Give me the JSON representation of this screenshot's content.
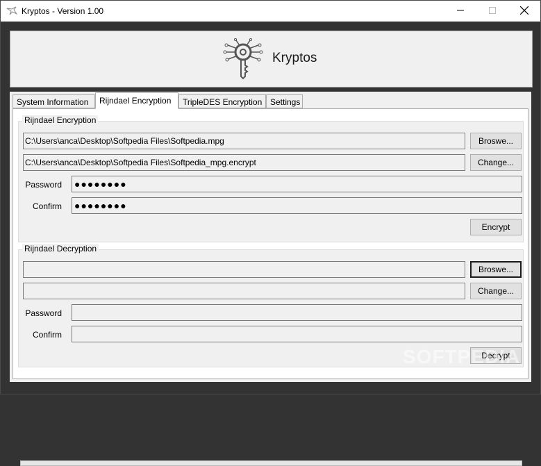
{
  "window": {
    "title": "Kryptos - Version 1.00",
    "icon": "bird-app-icon",
    "controls": {
      "minimize": "minimize-icon",
      "maximize": "maximize-icon",
      "close": "close-icon"
    }
  },
  "banner": {
    "title": "Kryptos",
    "logo": "key-circuit-logo"
  },
  "tabs": [
    {
      "label": "System Information"
    },
    {
      "label": "Rijndael Encryption"
    },
    {
      "label": "TripleDES Encryption"
    },
    {
      "label": "Settings"
    }
  ],
  "encryption": {
    "group_label": "Rijndael Encryption",
    "source_path": "C:\\Users\\anca\\Desktop\\Softpedia Files\\Softpedia.mpg",
    "dest_path": "C:\\Users\\anca\\Desktop\\Softpedia Files\\Softpedia_mpg.encrypt",
    "browse_label": "Broswe...",
    "change_label": "Change...",
    "password_label": "Password",
    "password_value": "●●●●●●●●",
    "confirm_label": "Confirm",
    "confirm_value": "●●●●●●●●",
    "action_label": "Encrypt"
  },
  "decryption": {
    "group_label": "Rijndael Decryption",
    "source_path": "",
    "dest_path": "",
    "browse_label": "Broswe...",
    "change_label": "Change...",
    "password_label": "Password",
    "password_value": "",
    "confirm_label": "Confirm",
    "confirm_value": "",
    "action_label": "Decrypt"
  },
  "watermark": "SOFTPEDIA"
}
